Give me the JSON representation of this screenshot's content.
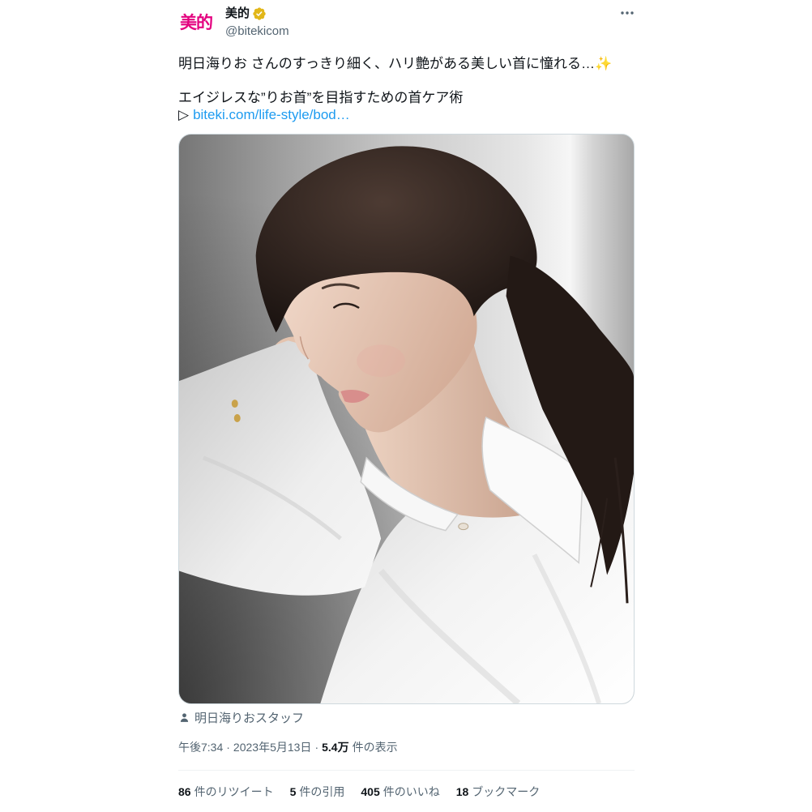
{
  "colors": {
    "text": "#0f1419",
    "secondary": "#536471",
    "link": "#1d9bf0",
    "brand": "#e4007f",
    "verified": "#e2b719",
    "border": "#cfd9de",
    "divider": "#eff3f4"
  },
  "tweet": {
    "avatar": {
      "logo_text": "美的"
    },
    "author": {
      "display_name": "美的",
      "handle": "@bitekicom",
      "badge_icon": "verified-badge-icon"
    },
    "more_icon": "more-horizontal-icon",
    "body": {
      "line1": "明日海りお さんのすっきり細く、ハリ艶がある美しい首に憧れる…✨",
      "line2": "エイジレスな”りお首”を目指すための首ケア術",
      "link_prefix": "▷",
      "link_text": "biteki.com/life-style/bod…"
    },
    "media": {
      "tag_icon": "person-icon",
      "tagged_user": "明日海りおスタッフ"
    },
    "meta": {
      "time": "午後7:34",
      "separator": "·",
      "date": "2023年5月13日",
      "views_count": "5.4万",
      "views_label": "件の表示"
    },
    "stats": [
      {
        "count": "86",
        "label": "件のリツイート"
      },
      {
        "count": "5",
        "label": "件の引用"
      },
      {
        "count": "405",
        "label": "件のいいね"
      },
      {
        "count": "18",
        "label": "ブックマーク"
      }
    ]
  }
}
